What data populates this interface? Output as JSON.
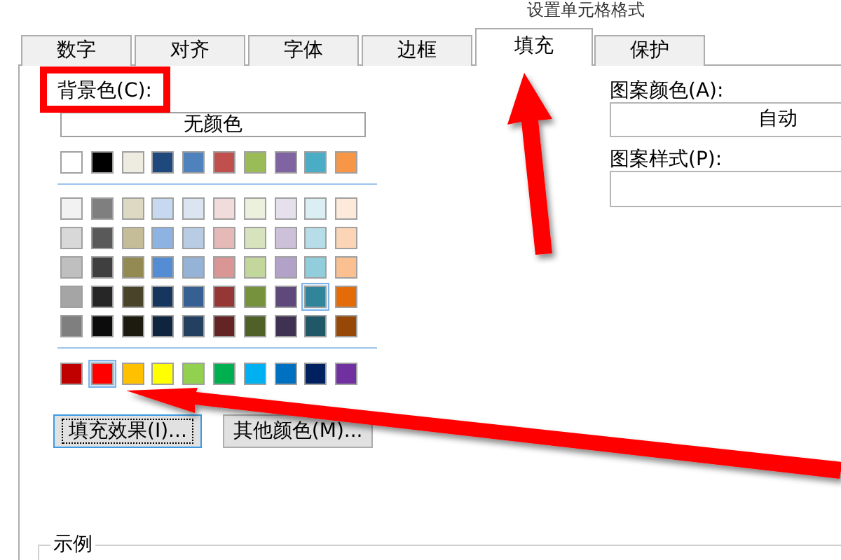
{
  "window": {
    "title": "设置单元格格式"
  },
  "tabs": [
    {
      "label": "数字",
      "selected": false
    },
    {
      "label": "对齐",
      "selected": false
    },
    {
      "label": "字体",
      "selected": false
    },
    {
      "label": "边框",
      "selected": false
    },
    {
      "label": "填充",
      "selected": true
    },
    {
      "label": "保护",
      "selected": false
    }
  ],
  "background": {
    "label": "背景色(C):",
    "no_color_button": "无颜色",
    "theme_colors": [
      {
        "color": "#ffffff",
        "selected": false
      },
      {
        "color": "#000000",
        "selected": false
      },
      {
        "color": "#eeece1",
        "selected": false
      },
      {
        "color": "#1f497d",
        "selected": false
      },
      {
        "color": "#4f81bd",
        "selected": false
      },
      {
        "color": "#c0504d",
        "selected": false
      },
      {
        "color": "#9bbb59",
        "selected": false
      },
      {
        "color": "#8064a2",
        "selected": false
      },
      {
        "color": "#4bacc6",
        "selected": false
      },
      {
        "color": "#f79646",
        "selected": false
      }
    ],
    "shades": [
      {
        "swatches": [
          {
            "color": "#f2f2f2",
            "selected": false,
            "highlighted": false
          },
          {
            "color": "#7f7f7f",
            "selected": false,
            "highlighted": false
          },
          {
            "color": "#ddd9c3",
            "selected": false,
            "highlighted": false
          },
          {
            "color": "#c6d9f0",
            "selected": false,
            "highlighted": false
          },
          {
            "color": "#dbe5f1",
            "selected": false,
            "highlighted": false
          },
          {
            "color": "#f2dcdb",
            "selected": false,
            "highlighted": false
          },
          {
            "color": "#ebf1dd",
            "selected": false,
            "highlighted": false
          },
          {
            "color": "#e5e0ec",
            "selected": false,
            "highlighted": false
          },
          {
            "color": "#dbeef3",
            "selected": false,
            "highlighted": false
          },
          {
            "color": "#fdeada",
            "selected": false,
            "highlighted": false
          }
        ]
      },
      {
        "swatches": [
          {
            "color": "#d8d8d8",
            "selected": false,
            "highlighted": false
          },
          {
            "color": "#595959",
            "selected": false,
            "highlighted": false
          },
          {
            "color": "#c4bd97",
            "selected": false,
            "highlighted": false
          },
          {
            "color": "#8db3e2",
            "selected": false,
            "highlighted": false
          },
          {
            "color": "#b8cce4",
            "selected": false,
            "highlighted": false
          },
          {
            "color": "#e5b9b7",
            "selected": false,
            "highlighted": false
          },
          {
            "color": "#d7e3bc",
            "selected": false,
            "highlighted": false
          },
          {
            "color": "#ccc1d9",
            "selected": false,
            "highlighted": false
          },
          {
            "color": "#b7dde8",
            "selected": false,
            "highlighted": false
          },
          {
            "color": "#fbd5b5",
            "selected": false,
            "highlighted": false
          }
        ]
      },
      {
        "swatches": [
          {
            "color": "#bfbfbf",
            "selected": false,
            "highlighted": false
          },
          {
            "color": "#3f3f3f",
            "selected": false,
            "highlighted": false
          },
          {
            "color": "#938953",
            "selected": false,
            "highlighted": false
          },
          {
            "color": "#548dd4",
            "selected": false,
            "highlighted": false
          },
          {
            "color": "#95b3d7",
            "selected": false,
            "highlighted": false
          },
          {
            "color": "#d99694",
            "selected": false,
            "highlighted": false
          },
          {
            "color": "#c3d69b",
            "selected": false,
            "highlighted": false
          },
          {
            "color": "#b2a2c7",
            "selected": false,
            "highlighted": false
          },
          {
            "color": "#92cddc",
            "selected": false,
            "highlighted": false
          },
          {
            "color": "#fac08f",
            "selected": false,
            "highlighted": false
          }
        ]
      },
      {
        "swatches": [
          {
            "color": "#a5a5a5",
            "selected": false,
            "highlighted": false
          },
          {
            "color": "#262626",
            "selected": false,
            "highlighted": false
          },
          {
            "color": "#494429",
            "selected": false,
            "highlighted": false
          },
          {
            "color": "#17365d",
            "selected": false,
            "highlighted": false
          },
          {
            "color": "#366092",
            "selected": false,
            "highlighted": false
          },
          {
            "color": "#953734",
            "selected": false,
            "highlighted": false
          },
          {
            "color": "#76923c",
            "selected": false,
            "highlighted": false
          },
          {
            "color": "#5f497a",
            "selected": false,
            "highlighted": false
          },
          {
            "color": "#31859b",
            "selected": false,
            "highlighted": true
          },
          {
            "color": "#e36c09",
            "selected": false,
            "highlighted": false
          }
        ]
      },
      {
        "swatches": [
          {
            "color": "#7f7f7f",
            "selected": false,
            "highlighted": false
          },
          {
            "color": "#0c0c0c",
            "selected": false,
            "highlighted": false
          },
          {
            "color": "#1d1b10",
            "selected": false,
            "highlighted": false
          },
          {
            "color": "#0f243e",
            "selected": false,
            "highlighted": false
          },
          {
            "color": "#244061",
            "selected": false,
            "highlighted": false
          },
          {
            "color": "#632423",
            "selected": false,
            "highlighted": false
          },
          {
            "color": "#4f6128",
            "selected": false,
            "highlighted": false
          },
          {
            "color": "#3f3151",
            "selected": false,
            "highlighted": false
          },
          {
            "color": "#205867",
            "selected": false,
            "highlighted": false
          },
          {
            "color": "#974806",
            "selected": false,
            "highlighted": false
          }
        ]
      }
    ],
    "standard_colors": [
      {
        "color": "#c00000",
        "selected": false
      },
      {
        "color": "#ff0000",
        "selected": true
      },
      {
        "color": "#ffc000",
        "selected": false
      },
      {
        "color": "#ffff00",
        "selected": false
      },
      {
        "color": "#92d050",
        "selected": false
      },
      {
        "color": "#00b050",
        "selected": false
      },
      {
        "color": "#00b0f0",
        "selected": false
      },
      {
        "color": "#0070c0",
        "selected": false
      },
      {
        "color": "#002060",
        "selected": false
      },
      {
        "color": "#7030a0",
        "selected": false
      }
    ]
  },
  "buttons": [
    {
      "label": "填充效果(I)...",
      "focused": true
    },
    {
      "label": "其他颜色(M)...",
      "focused": false
    }
  ],
  "pattern_color": {
    "label": "图案颜色(A):",
    "value": "自动"
  },
  "pattern_style": {
    "label": "图案样式(P):"
  },
  "sample": {
    "label": "示例"
  }
}
